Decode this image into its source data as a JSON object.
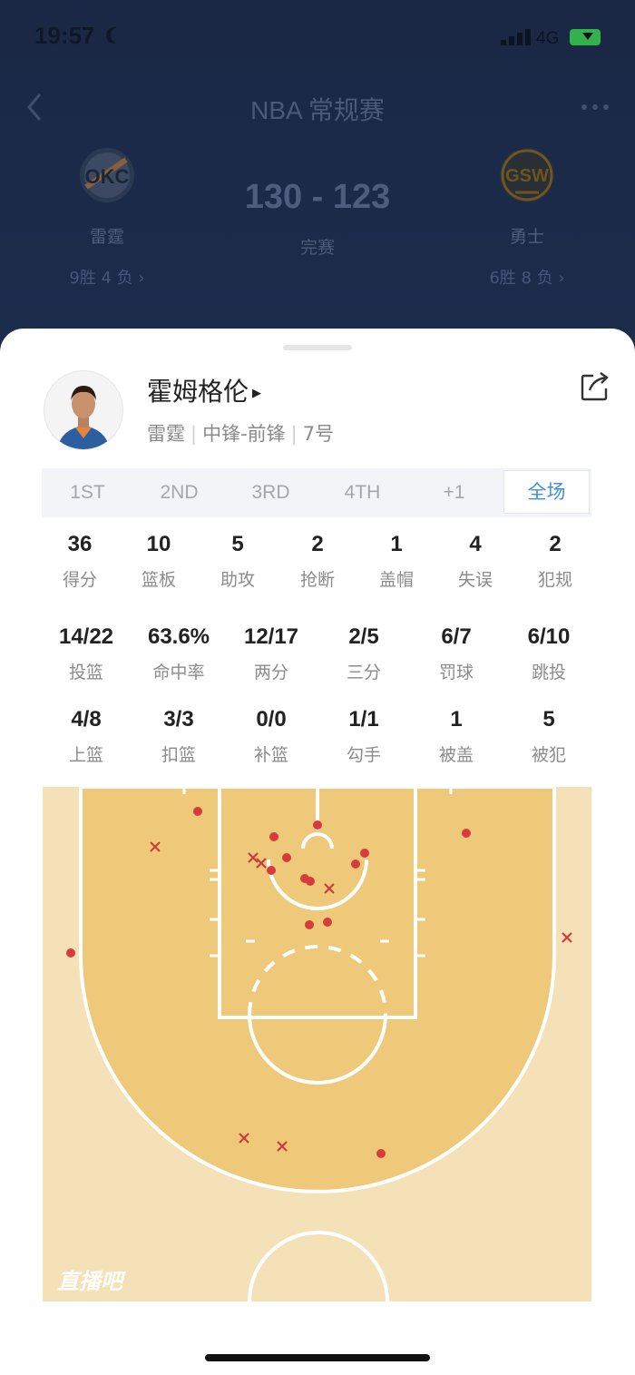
{
  "status_bar": {
    "time": "19:57",
    "network": "4G"
  },
  "header": {
    "title": "NBA 常规赛",
    "score": "130 - 123",
    "status": "完赛",
    "home": {
      "abbr": "OKC",
      "name": "雷霆",
      "record": "9胜 4 负 ›"
    },
    "away": {
      "abbr": "GSW",
      "name": "勇士",
      "record": "6胜 8 负 ›"
    }
  },
  "player": {
    "name": "霍姆格伦",
    "team": "雷霆",
    "position": "中锋-前锋",
    "number": "7号"
  },
  "tabs": [
    "1ST",
    "2ND",
    "3RD",
    "4TH",
    "+1",
    "全场"
  ],
  "active_tab": "全场",
  "stats_row1": [
    {
      "value": "36",
      "label": "得分"
    },
    {
      "value": "10",
      "label": "篮板"
    },
    {
      "value": "5",
      "label": "助攻"
    },
    {
      "value": "2",
      "label": "抢断"
    },
    {
      "value": "1",
      "label": "盖帽"
    },
    {
      "value": "4",
      "label": "失误"
    },
    {
      "value": "2",
      "label": "犯规"
    }
  ],
  "stats_row2": [
    {
      "value": "14/22",
      "label": "投篮"
    },
    {
      "value": "63.6%",
      "label": "命中率"
    },
    {
      "value": "12/17",
      "label": "两分"
    },
    {
      "value": "2/5",
      "label": "三分"
    },
    {
      "value": "6/7",
      "label": "罚球"
    },
    {
      "value": "6/10",
      "label": "跳投"
    }
  ],
  "stats_row3": [
    {
      "value": "4/8",
      "label": "上篮"
    },
    {
      "value": "3/3",
      "label": "扣篮"
    },
    {
      "value": "0/0",
      "label": "补篮"
    },
    {
      "value": "1/1",
      "label": "勾手"
    },
    {
      "value": "1",
      "label": "被盖"
    },
    {
      "value": "5",
      "label": "被犯"
    }
  ],
  "watermark": "直播吧",
  "colors": {
    "accent": "#3d8fd6",
    "made_shot": "#d63c3c",
    "missed_shot": "#d23a3a",
    "court_light": "#f5e1b8",
    "court_paint": "#efc97a"
  }
}
